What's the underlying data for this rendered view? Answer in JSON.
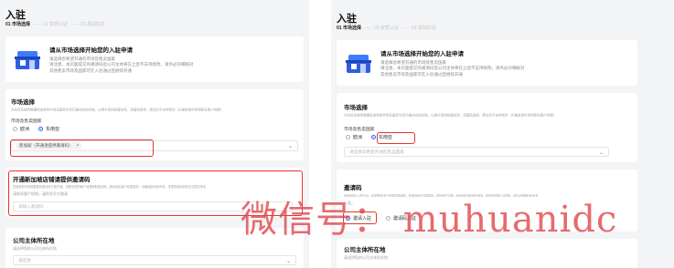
{
  "left": {
    "title": "入驻",
    "steps": [
      "01 市场选择",
      "02 资质认证",
      "03 基础信息"
    ],
    "banner": {
      "title": "请从市场选择开始您的入驻申请",
      "lines": [
        "请选择您希望开通的市场及售卖国家",
        "请注意，本页面提交的邀请码及公司主体将在之后不支持修改，请务必仔细核对",
        "其他售卖市场及国家可在入驻通过后继续开通"
      ]
    },
    "market": {
      "title": "市场选择",
      "desc": "开店后系统将根据您选择的市场及国家为您开通对应的店铺，以提升您的经营效率，请谨慎选择，提交后不支持修改（开通其他市场请联系客户经理）",
      "sub_label": "市场及售卖国家",
      "options": [
        "欧洲",
        "东南亚"
      ],
      "selected_tag": "新加坡（开通须提供邀请码）"
    },
    "invite": {
      "title": "开通新加坡店铺请提供邀请码",
      "desc": "您选择的市场需要提供邀请码才能开通，请联系您的客户经理获取邀请码，邀请码由客户经理发放，请确保邀请码有效，未提供邀请码将无法提交申请",
      "desc2": "请联系客户经理，谨防非官方邀请",
      "placeholder": "请输入邀请码"
    },
    "company": {
      "title": "公司主体所在地",
      "desc": "请选择您的公司主体所在地",
      "placeholder": "请选择"
    }
  },
  "right": {
    "title": "入驻",
    "steps": [
      "01 市场选择",
      "02 资质认证",
      "03 基础信息"
    ],
    "banner": {
      "title": "请从市场选择开始您的入驻申请",
      "lines": [
        "请选择您希望开通的市场及售卖国家",
        "请注意，本页面提交的邀请码及公司主体将在之后不支持修改，请务必仔细核对",
        "其他售卖市场及国家可在入驻通过后继续开通"
      ]
    },
    "market": {
      "title": "市场选择",
      "desc": "开店后系统将根据您选择的市场及国家为您开通对应的店铺，以提升您的经营效率，请谨慎选择，提交后不支持修改（开通其他市场请联系客户经理）",
      "sub_label": "市场及售卖国家",
      "options": [
        "欧洲",
        "东南亚"
      ],
      "placeholder": "请选择您希望开通的售卖国家"
    },
    "invite": {
      "title": "邀请码",
      "desc": "邀请码是您入驻的凭证，您需要联系客户经理获取邀请码，邀请码由客户经理发放，请联系客户经理，请谨慎核对邀请码有效性，避免影响您的入驻进程，请务必确保邀请码有效",
      "desc2": "入驻。",
      "options": [
        "邀请入驻",
        "邀请码入驻"
      ]
    },
    "company": {
      "title": "公司主体所在地",
      "desc": "请选择您的公司主体所在地"
    }
  },
  "watermark": "微信号： muhuanidc",
  "icons": {
    "banner_icon": "store-icon",
    "chevron": "chevron-down-icon",
    "tag_close": "close-icon"
  },
  "colors": {
    "highlight": "#e3342f",
    "accent": "#2f6bff",
    "watermark": "#e0474b"
  }
}
